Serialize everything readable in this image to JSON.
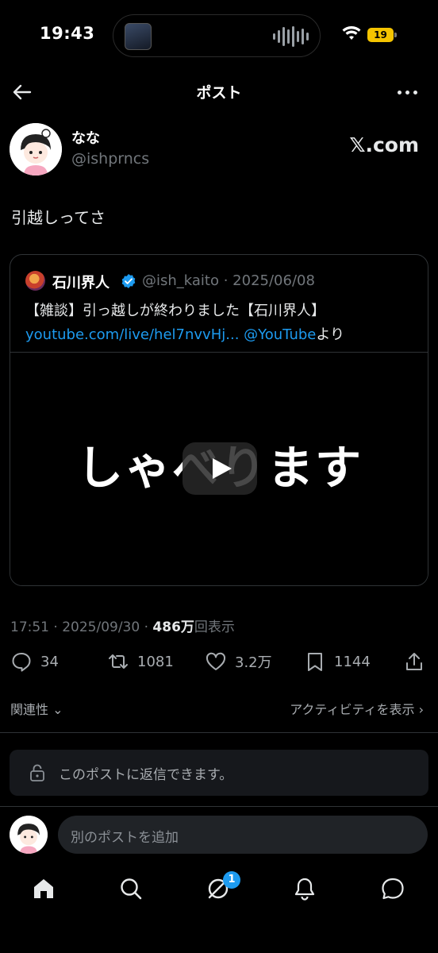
{
  "status_bar": {
    "time": "19:43",
    "battery": "19"
  },
  "header": {
    "title": "ポスト"
  },
  "author": {
    "name": "なな",
    "handle": "@ishprncs",
    "source": "𝕏.com"
  },
  "tweet": {
    "text": "引越しってさ"
  },
  "quote": {
    "name": "石川界人",
    "meta": "@ish_kaito · 2025/06/08",
    "line1": "【雑談】引っ越しが終わりました【石川界人】",
    "link1": "youtube.com/live/hel7nvvHj...",
    "link2": "@YouTube",
    "suffix": "より",
    "video_caption": "しゃべります"
  },
  "post_meta": {
    "time_date": "17:51 · 2025/09/30 · ",
    "views": "486万",
    "views_label": "回表示"
  },
  "actions": {
    "replies": "34",
    "reposts": "1081",
    "likes": "3.2万",
    "bookmarks": "1144"
  },
  "sort": {
    "label": "関連性",
    "activity": "アクティビティを表示"
  },
  "reply_restriction": {
    "text": "このポストに返信できます。"
  },
  "compose": {
    "placeholder": "別のポストを追加"
  },
  "nav": {
    "badge": "1"
  },
  "colors": {
    "accent": "#1d9bf0",
    "background": "#000000",
    "muted": "#71767b"
  }
}
